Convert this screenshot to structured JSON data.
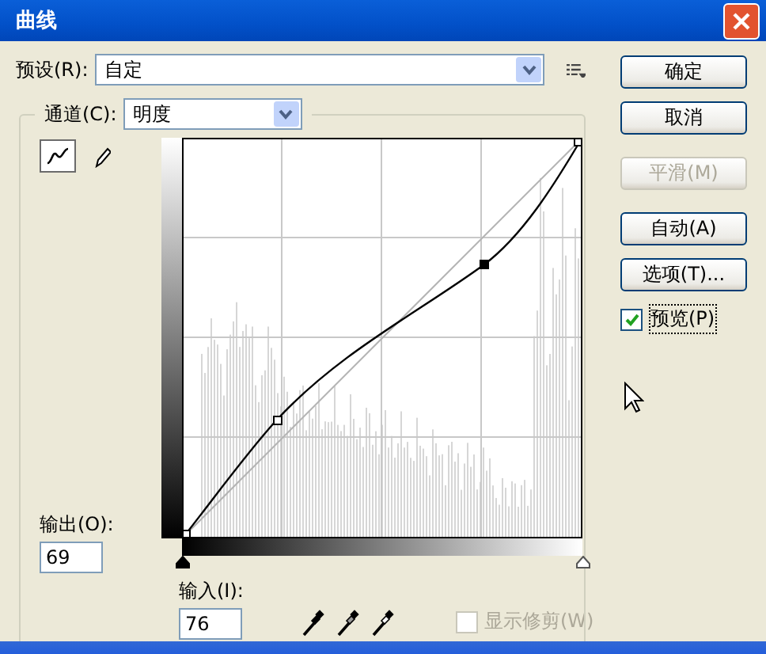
{
  "window": {
    "title": "曲线"
  },
  "preset": {
    "label": "预设(R):",
    "value": "自定"
  },
  "channel": {
    "label": "通道(C):",
    "value": "明度"
  },
  "tools": [
    {
      "kind": "curve",
      "selected": true
    },
    {
      "kind": "pencil",
      "selected": false
    }
  ],
  "output": {
    "label": "输出(O):",
    "value": "69"
  },
  "input": {
    "label": "输入(I):",
    "value": "76"
  },
  "input_sliders": [
    {
      "kind": "shadow",
      "level": 0
    },
    {
      "kind": "highlight",
      "level": 1
    }
  ],
  "show_clipping": {
    "label": "显示修剪(W)",
    "checked": false
  },
  "buttons": [
    {
      "label": "确定",
      "disabled": false
    },
    {
      "label": "取消",
      "disabled": false
    },
    {
      "label": "平滑(M)",
      "disabled": true
    },
    {
      "label": "自动(A)",
      "disabled": false
    },
    {
      "label": "选项(T)...",
      "disabled": false
    }
  ],
  "preview": {
    "label": "预览(P)",
    "checked": true
  }
}
